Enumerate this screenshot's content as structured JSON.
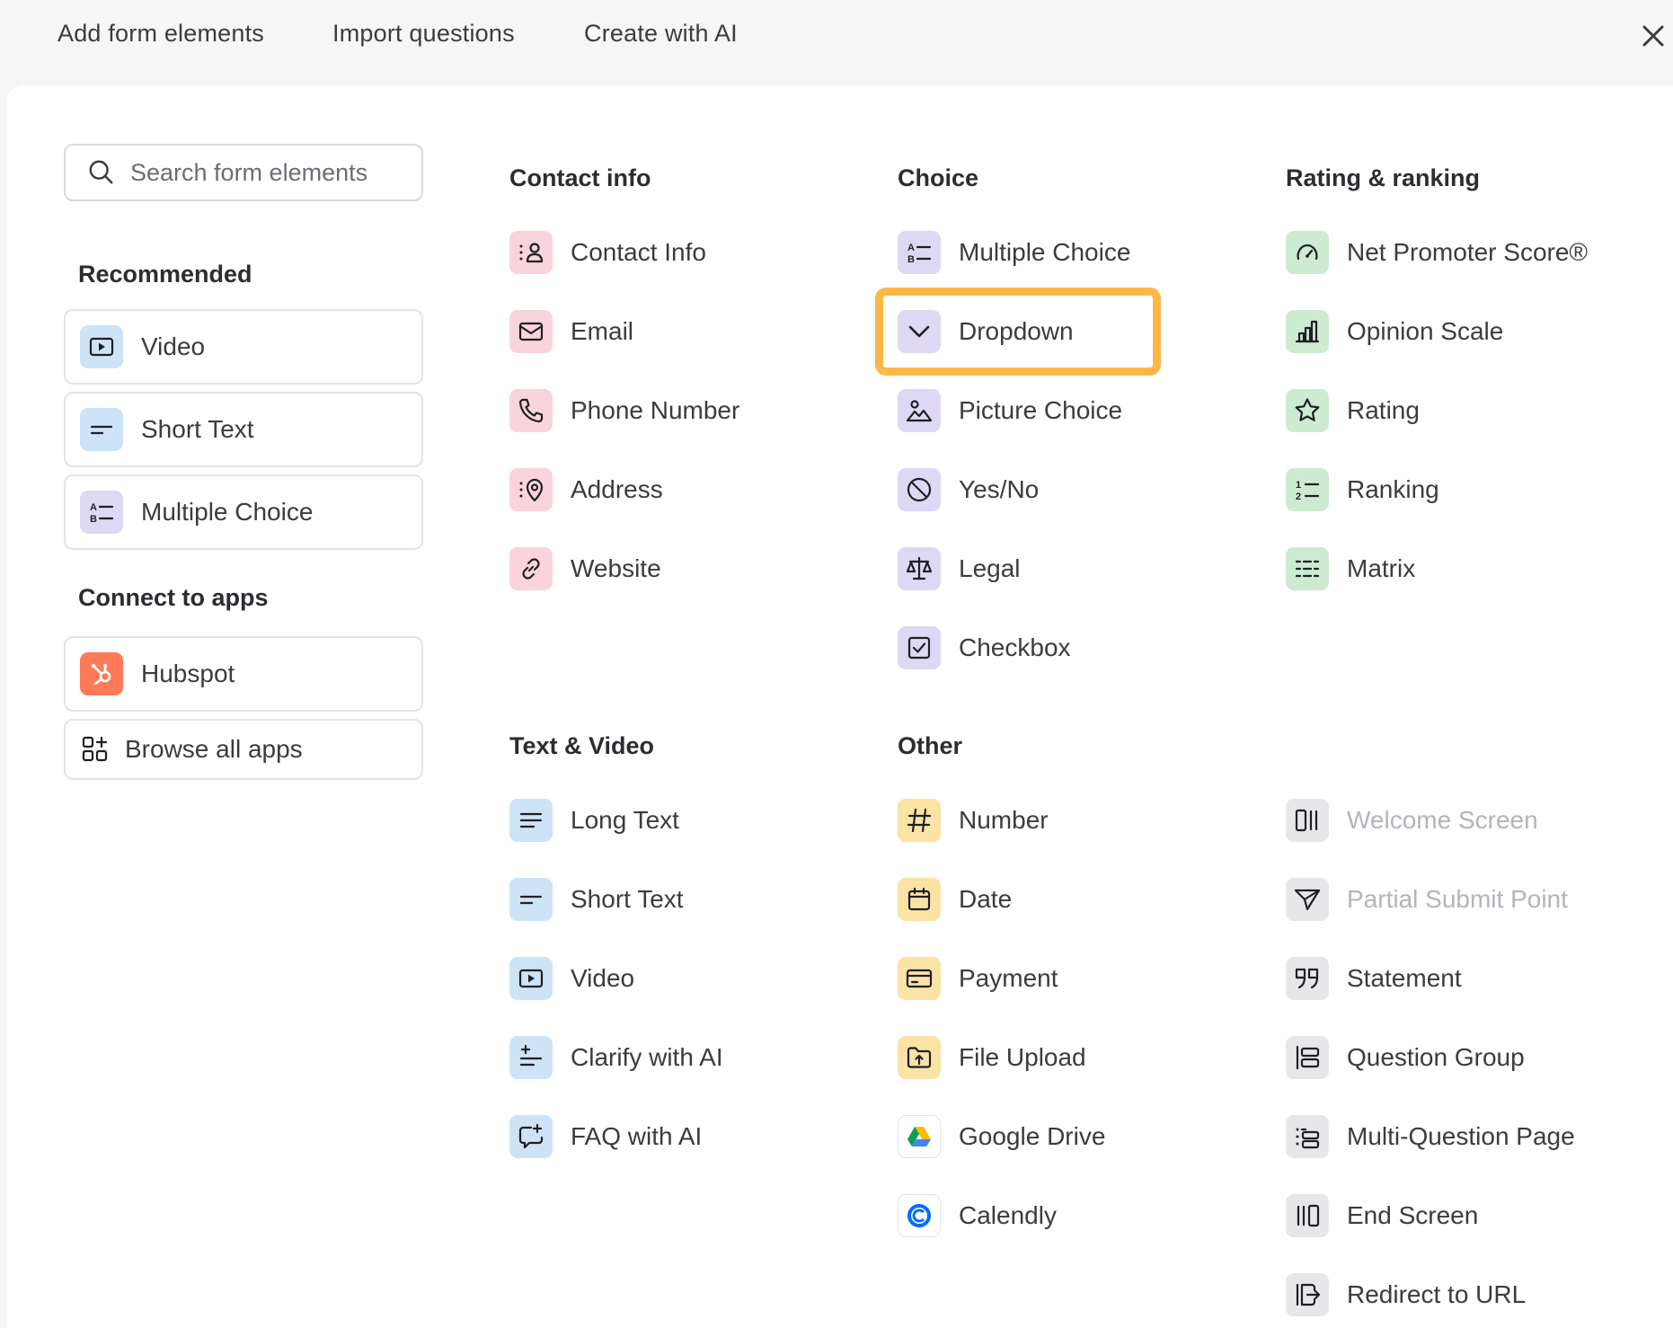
{
  "tabs": [
    "Add form elements",
    "Import questions",
    "Create with AI"
  ],
  "search": {
    "placeholder": "Search form elements"
  },
  "sidebar": {
    "recommended_heading": "Recommended",
    "recommended": [
      "Video",
      "Short Text",
      "Multiple Choice"
    ],
    "connect_heading": "Connect to apps",
    "apps": [
      "Hubspot",
      "Browse all apps"
    ]
  },
  "categories": {
    "contact_info": {
      "heading": "Contact info",
      "items": [
        "Contact Info",
        "Email",
        "Phone Number",
        "Address",
        "Website"
      ]
    },
    "choice": {
      "heading": "Choice",
      "items": [
        "Multiple Choice",
        "Dropdown",
        "Picture Choice",
        "Yes/No",
        "Legal",
        "Checkbox"
      ]
    },
    "rating": {
      "heading": "Rating & ranking",
      "items": [
        "Net Promoter Score®",
        "Opinion Scale",
        "Rating",
        "Ranking",
        "Matrix"
      ]
    },
    "text_video": {
      "heading": "Text & Video",
      "items": [
        "Long Text",
        "Short Text",
        "Video",
        "Clarify with AI",
        "FAQ with AI"
      ]
    },
    "other": {
      "heading": "Other",
      "items": [
        "Number",
        "Date",
        "Payment",
        "File Upload",
        "Google Drive",
        "Calendly"
      ],
      "items2": [
        "Welcome Screen",
        "Partial Submit Point",
        "Statement",
        "Question Group",
        "Multi-Question Page",
        "End Screen",
        "Redirect to URL"
      ]
    }
  },
  "colors": {
    "highlight": "#fbb848",
    "contact_tile": "#f9d4dc",
    "choice_tile": "#ded8f5",
    "rating_tile": "#cdebd1",
    "text_tile": "#cde3f8",
    "other_tile": "#fbe3a6",
    "structure_tile": "#e7e7ea"
  },
  "highlighted_item": "Dropdown"
}
